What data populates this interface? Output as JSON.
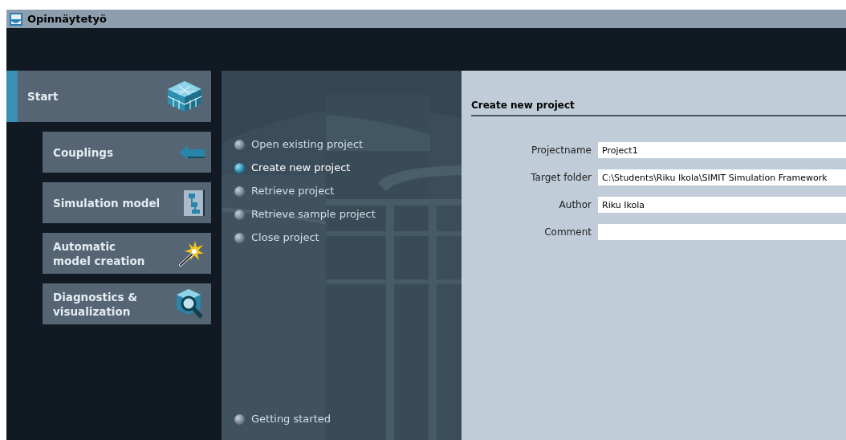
{
  "window": {
    "title": "Opinnäytetyö"
  },
  "nav": [
    {
      "label": "Start",
      "selected": true
    },
    {
      "label": "Couplings",
      "selected": false
    },
    {
      "label": "Simulation model",
      "selected": false
    },
    {
      "label": "Automatic\nmodel creation",
      "selected": false
    },
    {
      "label": "Diagnostics &\nvisualization",
      "selected": false
    }
  ],
  "actions": [
    {
      "label": "Open existing project",
      "selected": false
    },
    {
      "label": "Create new project",
      "selected": true
    },
    {
      "label": "Retrieve project",
      "selected": false
    },
    {
      "label": "Retrieve sample project",
      "selected": false
    },
    {
      "label": "Close project",
      "selected": false
    }
  ],
  "footer_action": {
    "label": "Getting started",
    "selected": false
  },
  "form": {
    "title": "Create new project",
    "fields": [
      {
        "label": "Projectname",
        "value": "Project1"
      },
      {
        "label": "Target folder",
        "value": "C:\\Students\\Riku Ikola\\SIMIT Simulation Framework"
      },
      {
        "label": "Author",
        "value": "Riku Ikola"
      },
      {
        "label": "Comment"
      }
    ]
  }
}
